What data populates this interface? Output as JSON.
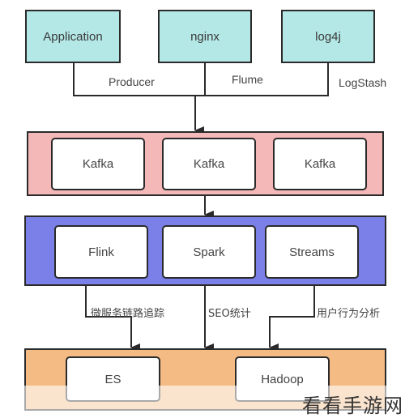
{
  "diagram": {
    "sources": [
      {
        "label": "Application"
      },
      {
        "label": "nginx"
      },
      {
        "label": "log4j"
      }
    ],
    "collectors": [
      {
        "label": "Producer"
      },
      {
        "label": "Flume"
      },
      {
        "label": "LogStash"
      }
    ],
    "queue_layer": {
      "nodes": [
        {
          "label": "Kafka"
        },
        {
          "label": "Kafka"
        },
        {
          "label": "Kafka"
        }
      ],
      "color": "#f4b8b8"
    },
    "processing_layer": {
      "nodes": [
        {
          "label": "Flink"
        },
        {
          "label": "Spark"
        },
        {
          "label": "Streams"
        }
      ],
      "color": "#7b7fe8"
    },
    "use_cases": [
      {
        "label": "微服务链路追踪"
      },
      {
        "label": "SEO统计"
      },
      {
        "label": "用户行为分析"
      }
    ],
    "storage_layer": {
      "nodes": [
        {
          "label": "ES"
        },
        {
          "label": "Hadoop"
        }
      ],
      "color": "#f4bb84"
    },
    "source_color": "#b3e8e6",
    "line_color": "#2a2a2a"
  },
  "watermark": "看看手游网"
}
